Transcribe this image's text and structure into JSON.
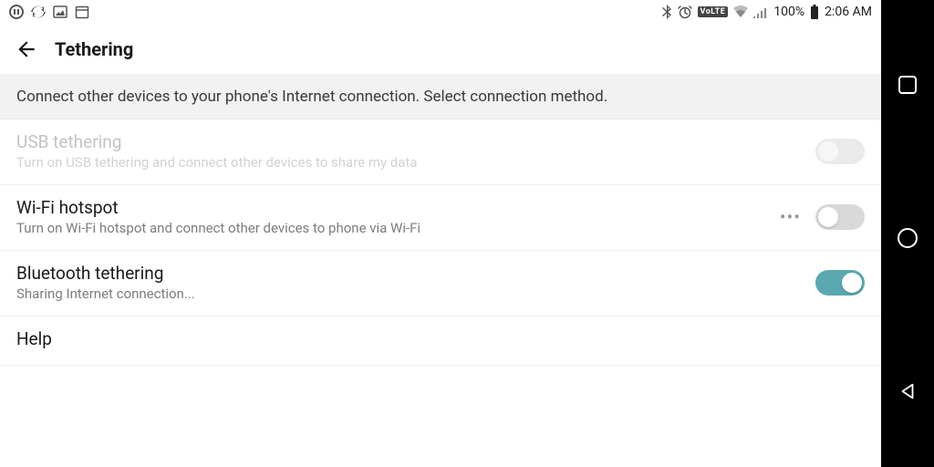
{
  "status": {
    "volte": "VoLTE",
    "battery_pct": "100%",
    "time": "2:06 AM"
  },
  "appbar": {
    "title": "Tethering"
  },
  "subheader": "Connect other devices to your phone's Internet connection. Select connection method.",
  "rows": {
    "usb": {
      "title": "USB tethering",
      "subtitle": "Turn on USB tethering and connect other devices to share my data"
    },
    "wifi": {
      "title": "Wi-Fi hotspot",
      "subtitle": "Turn on Wi-Fi hotspot and connect other devices to phone via Wi-Fi",
      "more": "•••"
    },
    "bt": {
      "title": "Bluetooth tethering",
      "subtitle": "Sharing Internet connection..."
    },
    "help": {
      "title": "Help"
    }
  }
}
